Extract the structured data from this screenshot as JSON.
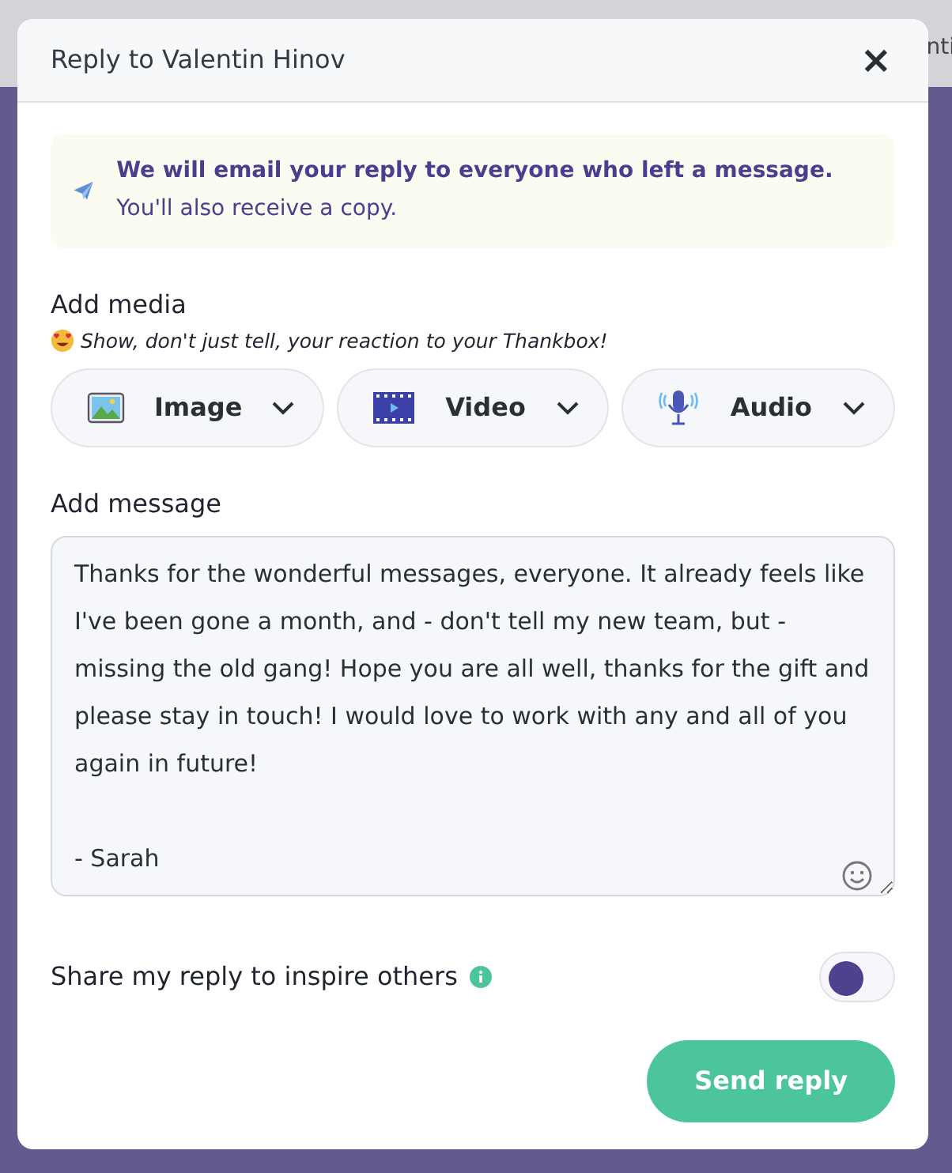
{
  "backdrop": {
    "header_text": "nti"
  },
  "dialog": {
    "title": "Reply to Valentin Hinov",
    "close": "×"
  },
  "notice": {
    "text": "**We will email your reply to everyone who left a message.** You'll also receive a copy."
  },
  "media": {
    "heading": "Add media",
    "hint": "Show, don't just tell, your reaction to your Thankbox!",
    "buttons": [
      {
        "kind": "image",
        "label": "Image"
      },
      {
        "kind": "video",
        "label": "Video"
      },
      {
        "kind": "audio",
        "label": "Audio"
      }
    ]
  },
  "message": {
    "heading": "Add message",
    "value": "Thanks for the wonderful messages, everyone. It already feels like I've been gone a month, and - don't tell my new team, but - missing the old gang! Hope you are all well, thanks for the gift and please stay in touch! I would love to work with any and all of you again in future!\n\n- Sarah"
  },
  "share": {
    "label": "Share my reply to inspire others",
    "on": false
  },
  "submit": "Send reply"
}
